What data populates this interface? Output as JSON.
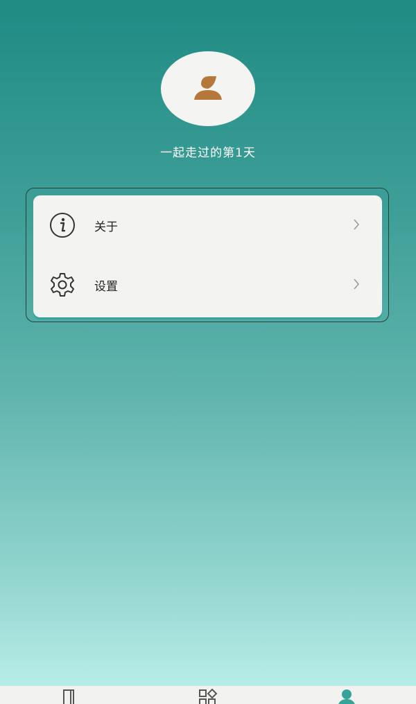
{
  "profile": {
    "greeting": "一起走过的第1天"
  },
  "menu": {
    "items": [
      {
        "label": "关于",
        "icon": "info-icon"
      },
      {
        "label": "设置",
        "icon": "gear-icon"
      }
    ]
  },
  "tabbar": {
    "tabs": [
      {
        "icon": "book-icon"
      },
      {
        "icon": "apps-icon"
      },
      {
        "icon": "person-icon",
        "active": true
      }
    ]
  },
  "colors": {
    "accent": "#35a39a",
    "avatar": "#b5783a",
    "background_top": "#1f8b83",
    "background_bottom": "#bdf0ec"
  }
}
